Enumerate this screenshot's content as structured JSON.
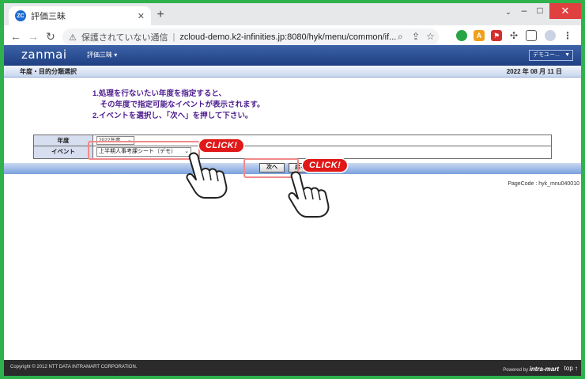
{
  "browser": {
    "tab_title": "評価三昧",
    "tab_favicon_text": "ZC",
    "security_label": "保護されていない通信",
    "url": "zcloud-demo.k2-infinities.jp:8080/hyk/menu/common/if..."
  },
  "header": {
    "logo": "zanmai",
    "app_menu_label": "評価三昧 ▾",
    "user_menu_label": "デモユー..."
  },
  "title_bar": {
    "title": "年度・目的分類選択",
    "date": "2022 年 08 月 11 日"
  },
  "instructions": [
    "1.処理を行ないたい年度を指定すると、",
    "　その年度で指定可能なイベントが表示されます。",
    "2.イベントを選択し、「次へ」を押して下さい。"
  ],
  "form": {
    "year_label": "年度",
    "year_value": "2022年度",
    "event_label": "イベント",
    "event_value": "上半期人事考課シート（デモ）"
  },
  "actions": {
    "next_label": "次へ",
    "back_label": "戻る"
  },
  "page_code": "PageCode : hyk_mnu040010",
  "footer": {
    "copyright": "Copyright © 2012 NTT DATA INTRAMART CORPORATION.",
    "powered_by": "Powered by",
    "brand": "intra-mart",
    "top_link": "top ↑"
  },
  "annotations": {
    "click_label": "CLICK!"
  },
  "colors": {
    "header_blue": "#1f3f82",
    "instruction_purple": "#4b1a8c",
    "click_red": "#e01818",
    "highlight_pink": "#f08a8a"
  }
}
